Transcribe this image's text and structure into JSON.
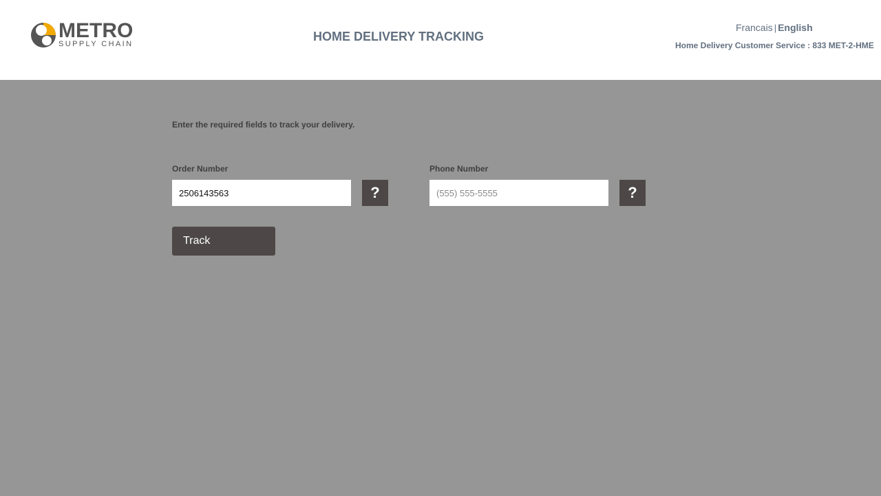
{
  "header": {
    "logo": {
      "word": "METRO",
      "sub": "SUPPLY CHAIN",
      "colors": {
        "accent": "#f2a900",
        "dark": "#555555"
      }
    },
    "title": "HOME DELIVERY TRACKING",
    "language": {
      "french": "Francais",
      "separator": "|",
      "english": "English"
    },
    "service": "Home Delivery Customer Service : 833 MET-2-HME"
  },
  "form": {
    "instructions": "Enter the required fields to track your delivery.",
    "order_number": {
      "label": "Order Number",
      "value": "2506143563",
      "help_icon": "question-mark-icon"
    },
    "phone_number": {
      "label": "Phone Number",
      "placeholder": "(555) 555-5555",
      "help_icon": "question-mark-icon"
    },
    "track_label": "Track"
  },
  "colors": {
    "background": "#969696",
    "header_text": "#627080",
    "button": "#4d4847"
  }
}
